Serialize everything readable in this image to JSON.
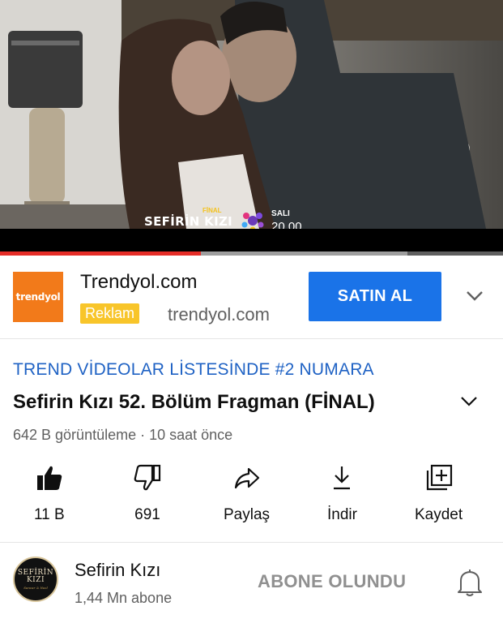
{
  "player": {
    "overlay_final": "FİNAL",
    "overlay_title": "SEFİRİN KIZI",
    "overlay_day": "SALI",
    "overlay_hour": "20.00",
    "progress_played": 0.4,
    "progress_buffered": 0.81
  },
  "ad": {
    "logo_text": "trendyol",
    "advertiser": "Trendyol.com",
    "badge": "Reklam",
    "domain": "trendyol.com",
    "cta": "SATIN AL",
    "brand_color": "#f27a1a",
    "cta_color": "#1a73e8"
  },
  "video": {
    "trending": "TREND VİDEOLAR LİSTESİNDE #2 NUMARA",
    "title": "Sefirin Kızı 52. Bölüm Fragman (FİNAL)",
    "meta": "642 B görüntüleme · 10 saat önce"
  },
  "actions": [
    {
      "icon": "thumbs-up-icon",
      "label": "11 B"
    },
    {
      "icon": "thumbs-down-icon",
      "label": "691"
    },
    {
      "icon": "share-icon",
      "label": "Paylaş"
    },
    {
      "icon": "download-icon",
      "label": "İndir"
    },
    {
      "icon": "save-playlist-icon",
      "label": "Kaydet"
    }
  ],
  "channel": {
    "avatar_line1": "SEFİRİN",
    "avatar_line2": "KIZI",
    "avatar_sub": "Sancar & Nazl",
    "name": "Sefirin Kızı",
    "subscribers": "1,44 Mn abone",
    "subscribe_state": "ABONE OLUNDU"
  }
}
